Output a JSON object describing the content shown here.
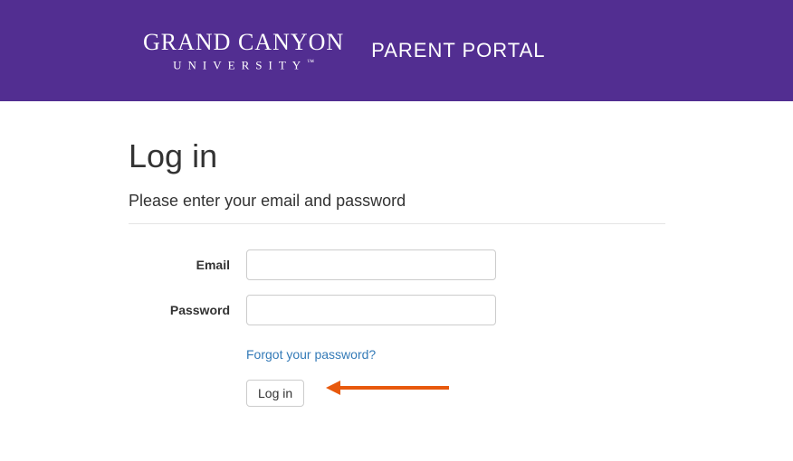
{
  "header": {
    "logo_line1": "GRAND CANYON",
    "logo_line2": "UNIVERSITY",
    "trademark": "™",
    "portal_label": "PARENT PORTAL"
  },
  "login": {
    "title": "Log in",
    "instruction": "Please enter your email and password",
    "email_label": "Email",
    "email_value": "",
    "password_label": "Password",
    "password_value": "",
    "forgot_link": "Forgot your password?",
    "submit_label": "Log in"
  }
}
